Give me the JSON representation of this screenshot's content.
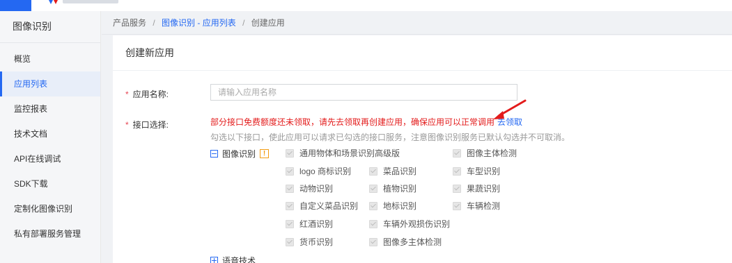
{
  "sidebar": {
    "title": "图像识别",
    "items": [
      {
        "label": "概览"
      },
      {
        "label": "应用列表"
      },
      {
        "label": "监控报表"
      },
      {
        "label": "技术文档"
      },
      {
        "label": "API在线调试"
      },
      {
        "label": "SDK下载"
      },
      {
        "label": "定制化图像识别"
      },
      {
        "label": "私有部署服务管理"
      }
    ],
    "active_index": 1
  },
  "breadcrumb": {
    "root": "产品服务",
    "sep": "/",
    "link": "图像识别 - 应用列表",
    "current": "创建应用"
  },
  "panel": {
    "title": "创建新应用"
  },
  "form": {
    "required_mark": "*",
    "name_label": "应用名称:",
    "name_placeholder": "请输入应用名称",
    "name_value": "",
    "api_label": "接口选择:",
    "warning_text": "部分接口免费额度还未领取，请先去领取再创建应用，确保应用可以正常调用",
    "claim_link": "去领取",
    "hint_text": "勾选以下接口，使此应用可以请求已勾选的接口服务，注意图像识别服务已默认勾选并不可取消。",
    "group_image": "图像识别",
    "group_warn_icon": "!",
    "group_voice": "语音技术",
    "checkboxes": [
      {
        "label": "通用物体和场景识别高级版",
        "checked": true,
        "disabled": true
      },
      {
        "label": "图像主体检测",
        "checked": true,
        "disabled": true
      },
      {
        "label": "logo 商标识别",
        "checked": true,
        "disabled": true
      },
      {
        "label": "菜品识别",
        "checked": true,
        "disabled": true
      },
      {
        "label": "车型识别",
        "checked": true,
        "disabled": true
      },
      {
        "label": "动物识别",
        "checked": true,
        "disabled": true
      },
      {
        "label": "植物识别",
        "checked": true,
        "disabled": true
      },
      {
        "label": "果蔬识别",
        "checked": true,
        "disabled": true
      },
      {
        "label": "自定义菜品识别",
        "checked": true,
        "disabled": true
      },
      {
        "label": "地标识别",
        "checked": true,
        "disabled": true
      },
      {
        "label": "车辆检测",
        "checked": true,
        "disabled": true
      },
      {
        "label": "红酒识别",
        "checked": true,
        "disabled": true
      },
      {
        "label": "车辆外观损伤识别",
        "checked": true,
        "disabled": true
      },
      {
        "label": "货币识别",
        "checked": true,
        "disabled": true
      },
      {
        "label": "图像多主体检测",
        "checked": true,
        "disabled": true
      }
    ]
  },
  "colors": {
    "accent": "#2468f2",
    "warning_red": "#e31b1b",
    "arrow_red": "#e31b1b",
    "required_red": "#e64552",
    "warn_icon_orange": "#f39c12"
  },
  "icons": {
    "annotation_arrow": "red-arrow-icon",
    "group_collapse": "minus-square-icon",
    "group_expand": "plus-square-icon",
    "group_warning": "exclamation-icon"
  }
}
